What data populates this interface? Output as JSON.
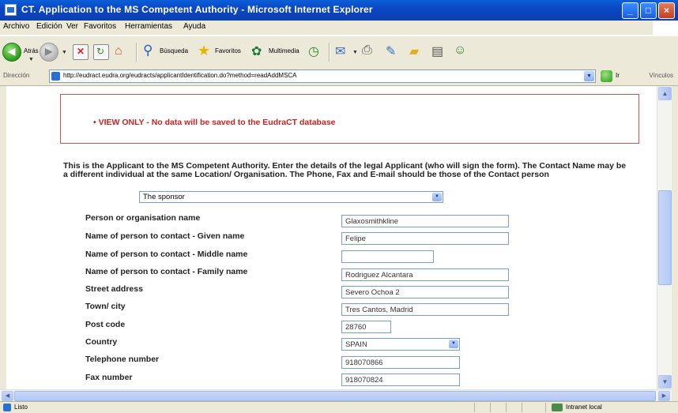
{
  "window": {
    "title": "CT. Application to the MS Competent Authority - Microsoft Internet Explorer",
    "controls": {
      "minimize": "_",
      "maximize": "□",
      "close": "×"
    }
  },
  "menubar": {
    "items": [
      "Archivo",
      "Edición",
      "Ver",
      "Favoritos",
      "Herramientas",
      "Ayuda"
    ]
  },
  "toolbar": {
    "back_label": "Atrás",
    "search_label": "Búsqueda",
    "favorites_label": "Favoritos",
    "multimedia_label": "Multimedia",
    "icons": [
      "back-icon",
      "forward-icon",
      "stop-icon",
      "refresh-icon",
      "home-icon",
      "search-icon",
      "favorites-icon",
      "multimedia-icon",
      "history-icon",
      "mail-icon",
      "print-icon",
      "edit-icon",
      "folder-icon",
      "discuss-icon",
      "messenger-icon"
    ]
  },
  "addressbar": {
    "label": "Dirección",
    "url": "http://eudract.eudra.org/eudracts/applicantIdentification.do?method=readAddMSCA",
    "go_label": "Ir",
    "links_label": "Vínculos"
  },
  "page": {
    "notice": "• VIEW ONLY - No data will be saved to the EudraCT database",
    "description": "This is the Applicant to the MS Competent Authority.   Enter the details of the legal Applicant (who will sign the form).   The Contact Name may be a different individual at the same Location/ Organisation.   The Phone, Fax and E-mail should be those of the Contact person",
    "applicant_type": "The sponsor",
    "fields": [
      {
        "label": "Person or organisation name",
        "value": "Glaxosmithkline"
      },
      {
        "label": "Name of person to contact - Given name",
        "value": "Felipe"
      },
      {
        "label": "Name of person to contact - Middle name",
        "value": ""
      },
      {
        "label": "Name of person to contact - Family name",
        "value": "Rodriguez Alcantara"
      },
      {
        "label": "Street address",
        "value": "Severo Ochoa 2"
      },
      {
        "label": "Town/ city",
        "value": "Tres Cantos, Madrid"
      },
      {
        "label": "Post code",
        "value": "28760"
      },
      {
        "label": "Country",
        "value": "SPAIN"
      },
      {
        "label": "Telephone number",
        "value": "918070866"
      },
      {
        "label": "Fax number",
        "value": "918070824"
      }
    ]
  },
  "statusbar": {
    "text": "Listo",
    "zone": "Intranet local"
  }
}
